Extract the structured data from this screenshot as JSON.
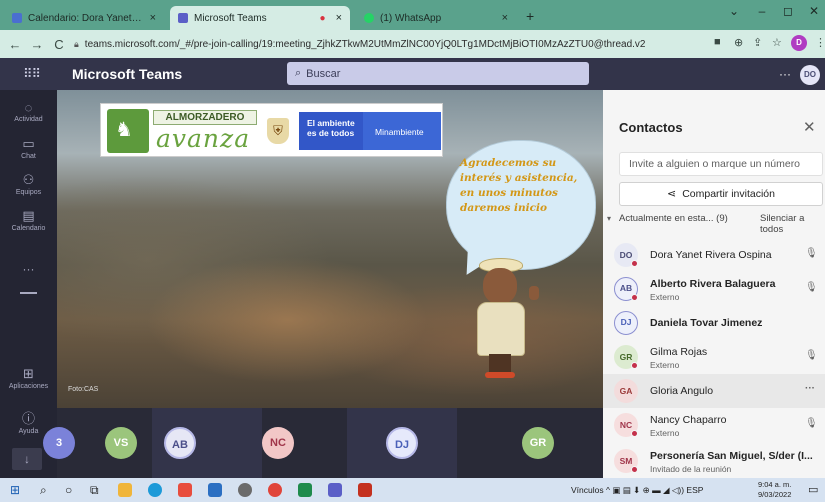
{
  "browser": {
    "tabs": [
      {
        "title": "Calendario: Dora Yanet Rivera Os",
        "active": false,
        "close": "×"
      },
      {
        "title": "Microsoft Teams",
        "active": true,
        "close": "×"
      },
      {
        "title": "(1) WhatsApp",
        "active": false,
        "close": "×"
      }
    ],
    "new_tab": "+",
    "url": "teams.microsoft.com/_#/pre-join-calling/19:meeting_ZjhkZTkwM2UtMmZlNC00YjQ0LTg1MDctMjBiOTI0MzAzZTU0@thread.v2",
    "profile_initial": "D"
  },
  "teams": {
    "app_title": "Microsoft Teams",
    "search_placeholder": "Buscar",
    "more": "···",
    "me_initials": "DO"
  },
  "rail": [
    {
      "label": "Actividad",
      "icon": "bell-icon",
      "glyph": "♫"
    },
    {
      "label": "Chat",
      "icon": "chat-icon",
      "glyph": "▭"
    },
    {
      "label": "Equipos",
      "icon": "teams-icon",
      "glyph": "⚇"
    },
    {
      "label": "Calendario",
      "icon": "calendar-icon",
      "glyph": "▤"
    },
    {
      "label": "",
      "icon": "more-apps-icon",
      "glyph": "···"
    },
    {
      "label": "Aplicaciones",
      "icon": "apps-icon",
      "glyph": "⊞"
    },
    {
      "label": "Ayuda",
      "icon": "help-icon",
      "glyph": "?"
    }
  ],
  "stage": {
    "brand_top": "ALMORZADERO",
    "brand_bottom": "avanza",
    "gov_tag": "El ambiente es de todos",
    "ministry": "Minambiente",
    "speech": "Agradecemos su interés y asistencia, en unos minutos daremos inicio",
    "photo_credit": "Foto:CAS"
  },
  "strip": [
    {
      "initials": "3",
      "bg": "#7b82d9",
      "fg": "#ffffff"
    },
    {
      "initials": "VS",
      "bg": "#9bc57c",
      "fg": "#ffffff"
    },
    {
      "initials": "AB",
      "bg": "#e6e7f5",
      "fg": "#4b4f8a"
    },
    {
      "initials": "NC",
      "bg": "#f2c7c7",
      "fg": "#a0354a"
    },
    {
      "initials": "DJ",
      "bg": "#e6e9fb",
      "fg": "#4a60b8"
    },
    {
      "initials": "GR",
      "bg": "#9bc57c",
      "fg": "#ffffff"
    }
  ],
  "panel": {
    "title": "Contactos",
    "close": "✕",
    "invite_placeholder": "Invite a alguien o marque un número",
    "share_label": "Compartir invitación",
    "section_label": "Actualmente en esta... (9)",
    "mute_all": "Silenciar a todos",
    "people": [
      {
        "initials": "DO",
        "name": "Dora Yanet Rivera Ospina",
        "sub": "",
        "bold": false,
        "bg": "#e7e9f4",
        "fg": "#4a4c74",
        "ring": false,
        "action": "mic-off-icon"
      },
      {
        "initials": "AB",
        "name": "Alberto Rivera Balaguera",
        "sub": "Externo",
        "bold": true,
        "bg": "#eef0fa",
        "fg": "#4b4f8a",
        "ring": true,
        "action": "mic-off-icon"
      },
      {
        "initials": "DJ",
        "name": "Daniela Tovar Jimenez",
        "sub": "",
        "bold": true,
        "bg": "#edf0fb",
        "fg": "#4a60b8",
        "ring": true,
        "action": ""
      },
      {
        "initials": "GR",
        "name": "Gilma Rojas",
        "sub": "Externo",
        "bold": false,
        "bg": "#dcebd0",
        "fg": "#466b2a",
        "ring": false,
        "action": "mic-off-icon"
      },
      {
        "initials": "GA",
        "name": "Gloria Angulo",
        "sub": "",
        "bold": false,
        "bg": "#f3dcdc",
        "fg": "#9b3a3a",
        "ring": false,
        "action": "more-icon"
      },
      {
        "initials": "NC",
        "name": "Nancy Chaparro",
        "sub": "Externo",
        "bold": false,
        "bg": "#f6dede",
        "fg": "#a0354a",
        "ring": false,
        "action": "mic-off-icon"
      },
      {
        "initials": "SM",
        "name": "Personería San Miguel, S/der (I...",
        "sub": "Invitado de la reunión",
        "bold": true,
        "bg": "#f6dede",
        "fg": "#a0354a",
        "ring": false,
        "action": ""
      }
    ]
  },
  "taskbar": {
    "tray": "Vínculos",
    "lang": "ESP",
    "time": "9:04 a. m.",
    "date": "9/03/2022"
  }
}
